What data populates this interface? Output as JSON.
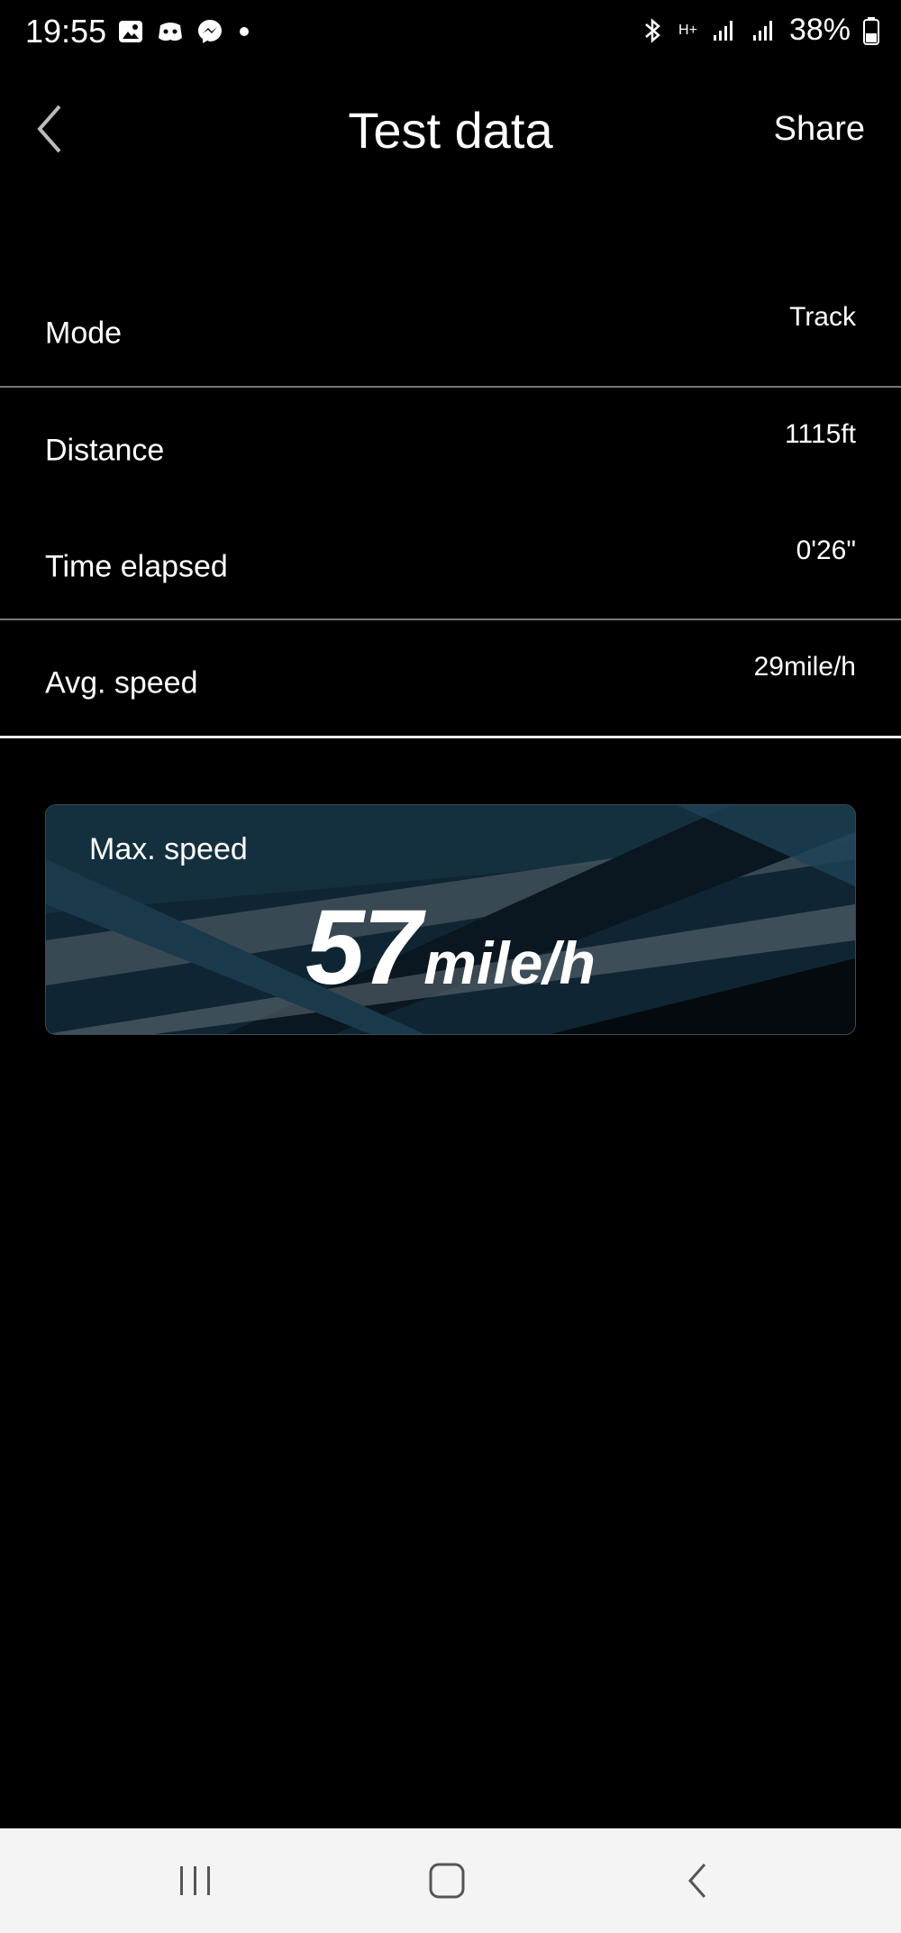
{
  "status_bar": {
    "time": "19:55",
    "battery": "38%",
    "network": "H+"
  },
  "header": {
    "title": "Test data",
    "share_label": "Share",
    "back_icon": "chevron-left-icon"
  },
  "rows": [
    {
      "label": "Mode",
      "value": "Track"
    },
    {
      "label": "Distance",
      "value": "1115ft"
    },
    {
      "label": "Time elapsed",
      "value": "0'26\""
    },
    {
      "label": "Avg. speed",
      "value": "29mile/h"
    }
  ],
  "max_speed": {
    "label": "Max. speed",
    "value": "57",
    "unit": "mile/h"
  },
  "navbar": {
    "recents_icon": "recents-icon",
    "home_icon": "home-icon",
    "back_icon": "back-icon"
  },
  "colors": {
    "background": "#000000",
    "text": "#ffffff",
    "navbar": "#f4f4f4",
    "card": "#0e1c26"
  }
}
